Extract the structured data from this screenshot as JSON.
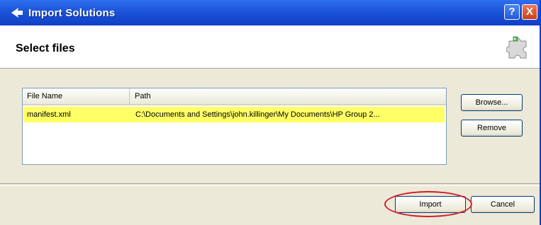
{
  "window": {
    "title": "Import Solutions",
    "help": "?",
    "close": "X"
  },
  "header": {
    "title": "Select files"
  },
  "file_list": {
    "columns": [
      "File Name",
      "Path"
    ],
    "rows": [
      {
        "file_name": "manifest.xml",
        "path": "C:\\Documents and Settings\\john.killinger\\My Documents\\HP Group 2..."
      }
    ]
  },
  "buttons": {
    "browse": "Browse...",
    "remove": "Remove",
    "import": "Import",
    "cancel": "Cancel"
  },
  "colors": {
    "titlebar": "#1c54d8",
    "selected_row": "#ffff66",
    "highlight_circle": "#d21e2a"
  }
}
